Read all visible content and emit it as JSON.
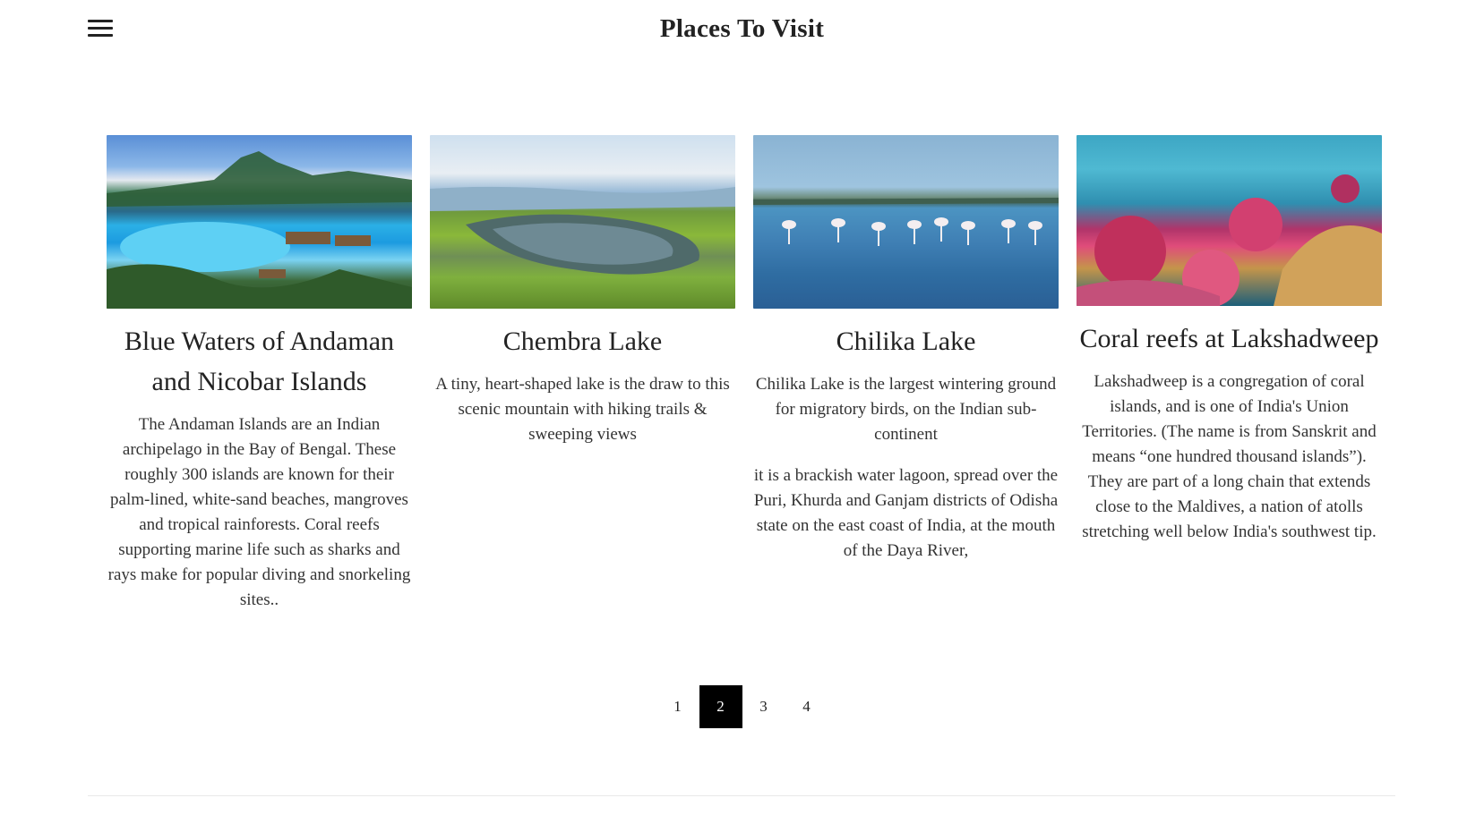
{
  "header": {
    "menu_icon": "hamburger-menu-icon",
    "title": "Places To Visit"
  },
  "cards": [
    {
      "image_alt": "tropical island resort with blue lagoon",
      "title": "Blue Waters of Andaman and Nicobar Islands",
      "paragraphs": [
        "The Andaman Islands are an Indian archipelago in the Bay of Bengal. These roughly 300 islands are known for their palm-lined, white-sand beaches, mangroves and tropical rainforests. Coral reefs supporting marine life such as sharks and rays make for popular diving and snorkeling sites.."
      ]
    },
    {
      "image_alt": "heart-shaped lake on green hills",
      "title": "Chembra Lake",
      "paragraphs": [
        "A tiny, heart-shaped lake is the draw to this scenic mountain with hiking trails & sweeping views"
      ]
    },
    {
      "image_alt": "flamingos in shallow lagoon water",
      "title": "Chilika Lake",
      "paragraphs": [
        "Chilika Lake is the largest wintering ground for migratory birds, on the Indian sub-continent",
        "it is a brackish water lagoon, spread over the Puri, Khurda and Ganjam districts of Odisha state on the east coast of India, at the mouth of the Daya River,"
      ]
    },
    {
      "image_alt": "colorful coral reef underwater",
      "title": "Coral reefs at Lakshadweep",
      "paragraphs": [
        "Lakshadweep is a congregation of coral islands, and is one of India's Union Territories. (The name is from Sanskrit and means “one hundred thousand islands”). They are part of a long chain that extends close to the Maldives, a nation of atolls stretching well below India's southwest tip."
      ]
    }
  ],
  "pagination": {
    "pages": [
      "1",
      "2",
      "3",
      "4"
    ],
    "current": "2"
  }
}
